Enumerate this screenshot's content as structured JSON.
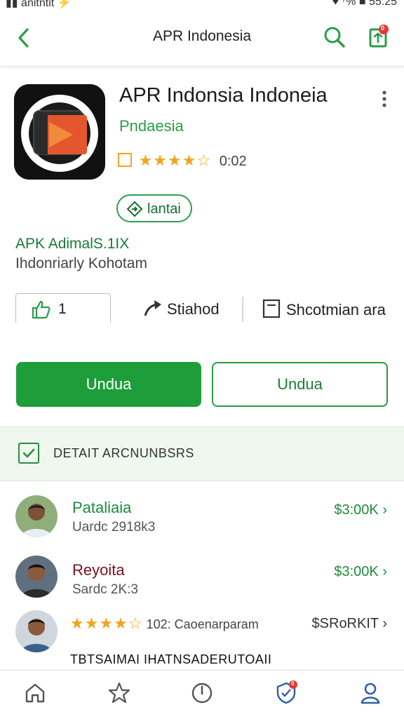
{
  "status_bar": {
    "left": "▮▮ anitntit ⚡",
    "right": "♥ ⁷% ■ 55:25"
  },
  "header": {
    "title": "APR Indonesia",
    "notification_count": "0"
  },
  "app": {
    "title": "APR Indonsia Indoneia",
    "developer": "Pndaesia",
    "rating": 4.5,
    "rating_label": "0:02",
    "install_label": "lantai",
    "meta_line1": "APK AdimalS.1IX",
    "meta_line2": "Ihdonriarly Kohotam"
  },
  "actions": {
    "like_count": "1",
    "share_label": "Stiahod",
    "save_label": "Shcotmian ara"
  },
  "buttons": {
    "primary": "Undua",
    "secondary": "Undua"
  },
  "details": {
    "label": "DETAIT ARCNUNBSRS"
  },
  "list": [
    {
      "name": "Pataliaia",
      "sub": "Uardc 2918k3",
      "price": "$3:00K",
      "name_color": "#1d8a3a"
    },
    {
      "name": "Reyoita",
      "sub": "Sardc 2K:3",
      "price": "$3:00K",
      "name_color": "#7a1020"
    },
    {
      "rating": 4.5,
      "review": "102: Caoenarparam",
      "price": "$SRoRKIT"
    }
  ],
  "bottom_title": "TBTSAIMAI IHATNSADERUTOAII",
  "nav": {
    "badge": "0"
  },
  "colors": {
    "accent": "#1e9e3a",
    "star": "#f1a51b",
    "badge": "#e53935"
  }
}
